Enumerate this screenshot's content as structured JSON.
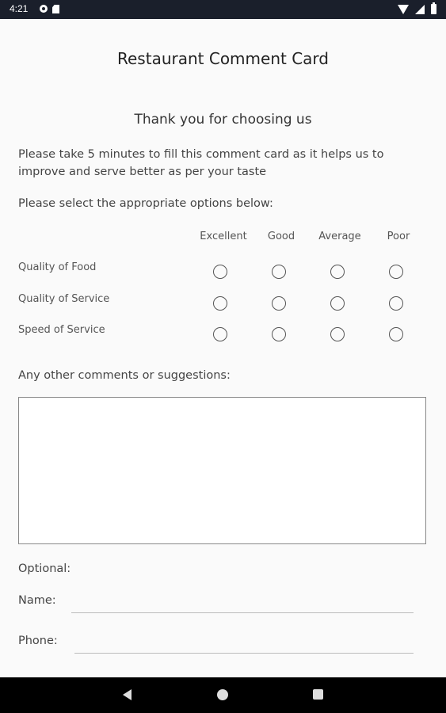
{
  "status_bar": {
    "time": "4:21",
    "icons": [
      "settings-icon",
      "sd-card-icon",
      "wifi-icon",
      "signal-icon",
      "battery-icon"
    ]
  },
  "title": "Restaurant Comment Card",
  "subtitle": "Thank you for choosing us",
  "intro": "Please take 5 minutes to fill this comment card as it helps us to improve and serve better as per your taste",
  "select_label": "Please select the appropriate options below:",
  "rating": {
    "columns": [
      "Excellent",
      "Good",
      "Average",
      "Poor"
    ],
    "rows": [
      "Quality of Food",
      "Quality of Service",
      "Speed of Service"
    ]
  },
  "comments": {
    "label": "Any other comments or suggestions:",
    "value": ""
  },
  "optional_label": "Optional:",
  "name_field": {
    "label": "Name:",
    "value": ""
  },
  "phone_field": {
    "label": "Phone:",
    "value": ""
  },
  "nav_bar": {
    "icons": [
      "back-icon",
      "home-icon",
      "recents-icon"
    ]
  },
  "colors": {
    "status_bar": "#1a1f2b",
    "background": "#fafafa",
    "nav_bar": "#000000"
  }
}
